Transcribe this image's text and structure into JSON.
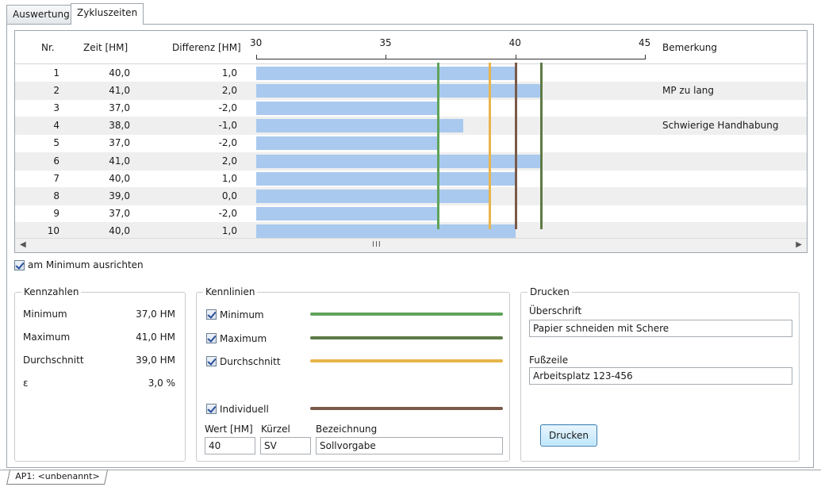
{
  "tabs": [
    {
      "label": "Auswertung",
      "active": false
    },
    {
      "label": "Zykluszeiten",
      "active": true
    }
  ],
  "grid": {
    "headers": {
      "nr": "Nr.",
      "zeit": "Zeit [HM]",
      "differenz": "Differenz [HM]",
      "bemerkung": "Bemerkung"
    },
    "axis": {
      "min": 30,
      "max": 45,
      "ticks": [
        "30",
        "35",
        "40",
        "45"
      ]
    },
    "rows": [
      {
        "nr": "1",
        "zeit": "40,0",
        "diff": "1,0",
        "value": 40,
        "bemerkung": ""
      },
      {
        "nr": "2",
        "zeit": "41,0",
        "diff": "2,0",
        "value": 41,
        "bemerkung": "MP zu lang"
      },
      {
        "nr": "3",
        "zeit": "37,0",
        "diff": "-2,0",
        "value": 37,
        "bemerkung": ""
      },
      {
        "nr": "4",
        "zeit": "38,0",
        "diff": "-1,0",
        "value": 38,
        "bemerkung": "Schwierige Handhabung"
      },
      {
        "nr": "5",
        "zeit": "37,0",
        "diff": "-2,0",
        "value": 37,
        "bemerkung": ""
      },
      {
        "nr": "6",
        "zeit": "41,0",
        "diff": "2,0",
        "value": 41,
        "bemerkung": ""
      },
      {
        "nr": "7",
        "zeit": "40,0",
        "diff": "1,0",
        "value": 40,
        "bemerkung": ""
      },
      {
        "nr": "8",
        "zeit": "39,0",
        "diff": "0,0",
        "value": 39,
        "bemerkung": ""
      },
      {
        "nr": "9",
        "zeit": "37,0",
        "diff": "-2,0",
        "value": 37,
        "bemerkung": ""
      },
      {
        "nr": "10",
        "zeit": "40,0",
        "diff": "1,0",
        "value": 40,
        "bemerkung": ""
      }
    ],
    "reference_lines": [
      {
        "name": "Minimum",
        "value": 37,
        "color": "#5fa35a"
      },
      {
        "name": "Durchschnitt",
        "value": 39,
        "color": "#e8b54b"
      },
      {
        "name": "Individuell",
        "value": 40,
        "color": "#7a5a4a"
      },
      {
        "name": "Maximum",
        "value": 41,
        "color": "#5d7a45"
      }
    ],
    "scrollbar_grip": "III"
  },
  "align_minimum": {
    "label": "am Minimum ausrichten",
    "checked": true
  },
  "kennzahlen": {
    "title": "Kennzahlen",
    "items": [
      {
        "label": "Minimum",
        "value": "37,0 HM"
      },
      {
        "label": "Maximum",
        "value": "41,0 HM"
      },
      {
        "label": "Durchschnitt",
        "value": "39,0 HM"
      },
      {
        "label": "ε",
        "value": "3,0 %"
      }
    ]
  },
  "kennlinien": {
    "title": "Kennlinien",
    "items": [
      {
        "label": "Minimum",
        "checked": true,
        "color": "#5fa35a"
      },
      {
        "label": "Maximum",
        "checked": true,
        "color": "#5d7a45"
      },
      {
        "label": "Durchschnitt",
        "checked": true,
        "color": "#e8b54b"
      },
      {
        "label": "Individuell",
        "checked": true,
        "color": "#7a5a4a"
      }
    ],
    "wert_label": "Wert [HM]",
    "kuerzel_label": "Kürzel",
    "bezeichnung_label": "Bezeichnung",
    "wert_value": "40",
    "kuerzel_value": "SV",
    "bezeichnung_value": "Sollvorgabe"
  },
  "drucken": {
    "title": "Drucken",
    "ueberschrift_label": "Überschrift",
    "ueberschrift_value": "Papier schneiden mit Schere",
    "fusszeile_label": "Fußzeile",
    "fusszeile_value": "Arbeitsplatz 123-456",
    "button_label": "Drucken"
  },
  "sheet_tab": "AP1: <unbenannt>"
}
